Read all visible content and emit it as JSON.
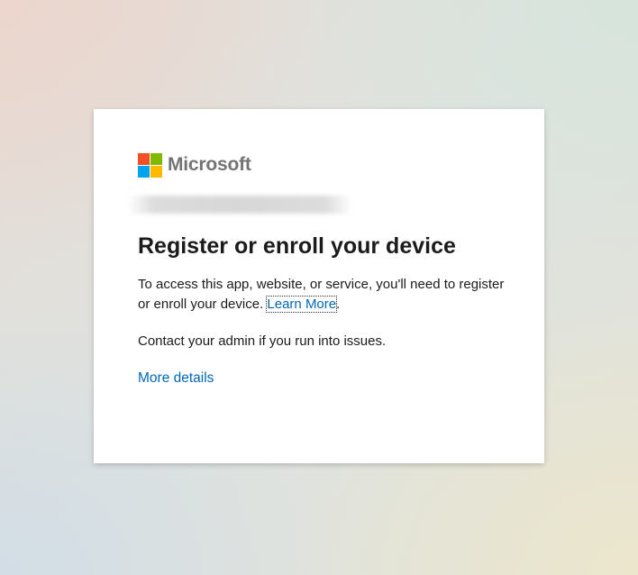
{
  "brand": {
    "name": "Microsoft",
    "logo_colors": [
      "#f25022",
      "#7fba00",
      "#00a4ef",
      "#ffb900"
    ]
  },
  "colors": {
    "link": "#0067b8",
    "text": "#1b1b1b"
  },
  "dialog": {
    "title": "Register or enroll your device",
    "description_prefix": "To access this app, website, or service, you'll need to register or enroll your device. ",
    "learn_more_label": "Learn More",
    "description_suffix": ".",
    "contact_text": "Contact your admin if you run into issues.",
    "more_details_label": "More details"
  }
}
